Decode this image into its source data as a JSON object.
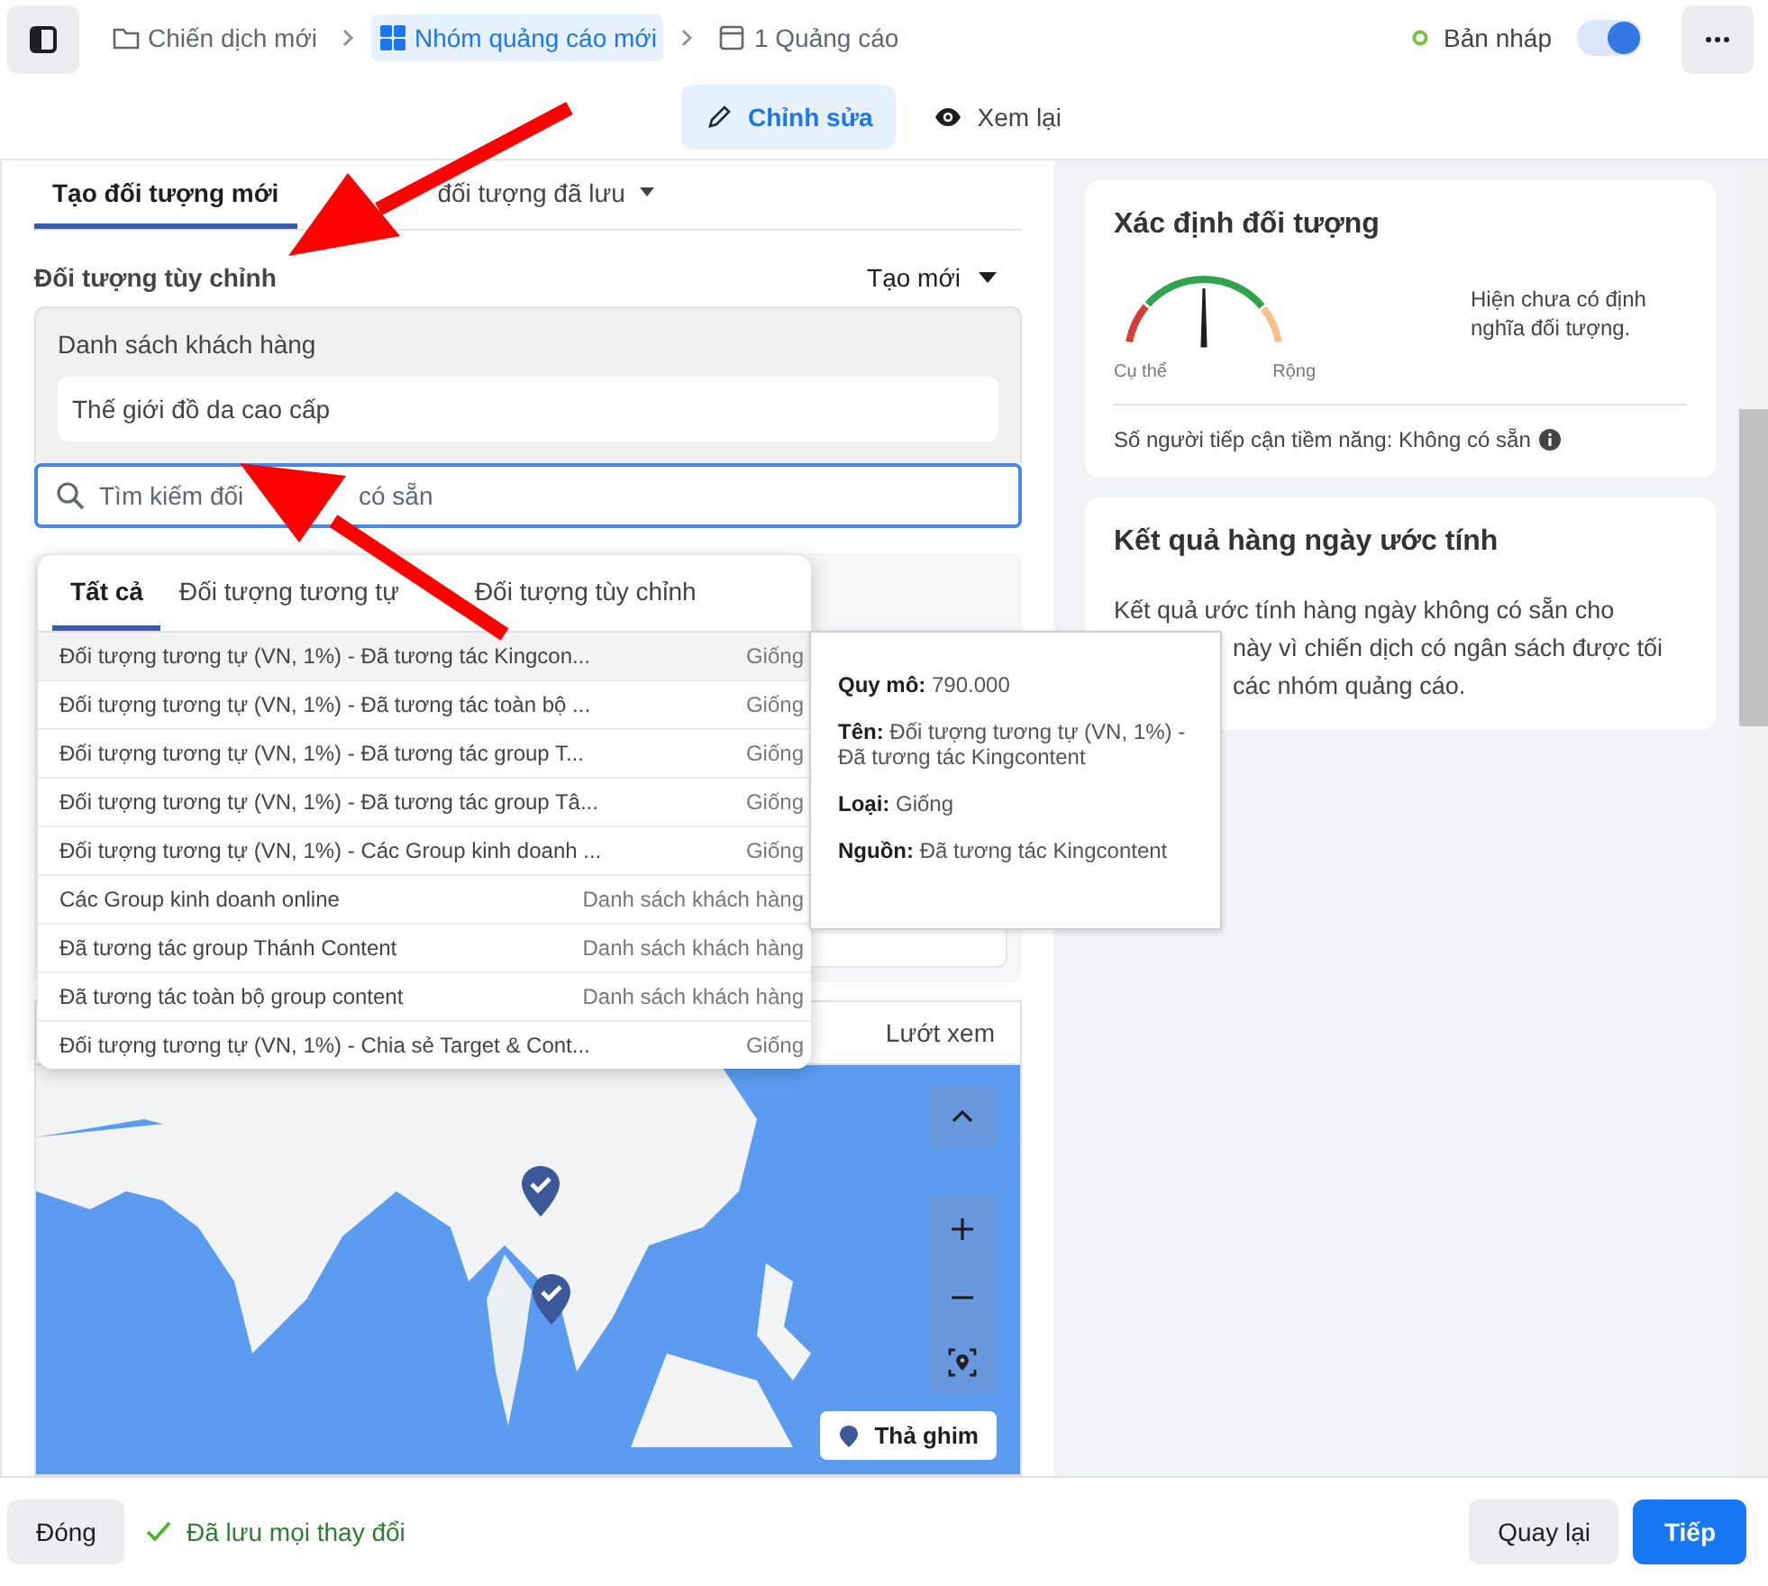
{
  "header": {
    "breadcrumbs": [
      {
        "label": "Chiến dịch mới",
        "kind": "campaign",
        "selected": false
      },
      {
        "label": "Nhóm quảng cáo mới",
        "kind": "adset",
        "selected": true
      },
      {
        "label": "1 Quảng cáo",
        "kind": "ad",
        "selected": false
      }
    ],
    "status": "Bản nháp",
    "toggle": {
      "on": true
    }
  },
  "modes": [
    {
      "label": "Chỉnh sửa",
      "kind": "edit",
      "selected": true
    },
    {
      "label": "Xem lại",
      "kind": "view",
      "selected": false
    }
  ],
  "audience_tabs": [
    {
      "label": "Tạo đối tượng mới",
      "selected": true,
      "dropdown": false
    },
    {
      "label": "đối tượng đã lưu",
      "selected": false,
      "dropdown": true
    }
  ],
  "custom_audience": {
    "title": "Đối tượng tùy chỉnh",
    "create_button": "Tạo mới",
    "group_label": "Danh sách khách hàng",
    "chips": [
      "Thế giới đồ da cao cấp"
    ],
    "search": {
      "placeholder": "Tìm kiếm đối",
      "placeholder_end": "có sẵn"
    }
  },
  "dropdown": {
    "tabs": [
      {
        "label": "Tất cả",
        "selected": true
      },
      {
        "label": "Đối tượng tương tự",
        "selected": false
      },
      {
        "label": "Đối tượng tùy chỉnh",
        "selected": false
      }
    ],
    "rows": [
      {
        "name": "Đối tượng tương tự (VN, 1%) - Đã tương tác Kingcon...",
        "type": "Giống",
        "highlighted": true
      },
      {
        "name": "Đối tượng tương tự (VN, 1%) - Đã tương tác toàn bộ ...",
        "type": "Giống",
        "highlighted": false
      },
      {
        "name": "Đối tượng tương tự (VN, 1%) - Đã tương tác group T...",
        "type": "Giống",
        "highlighted": false
      },
      {
        "name": "Đối tượng tương tự (VN, 1%) - Đã tương tác group Tâ...",
        "type": "Giống",
        "highlighted": false
      },
      {
        "name": "Đối tượng tương tự (VN, 1%) - Các Group kinh doanh ...",
        "type": "Giống",
        "highlighted": false
      },
      {
        "name": "Các Group kinh doanh online",
        "type": "Danh sách khách hàng",
        "highlighted": false
      },
      {
        "name": "Đã tương tác group Thánh Content",
        "type": "Danh sách khách hàng",
        "highlighted": false
      },
      {
        "name": "Đã tương tác toàn bộ group content",
        "type": "Danh sách khách hàng",
        "highlighted": false
      },
      {
        "name": "Đối tượng tương tự (VN, 1%) - Chia sẻ Target & Cont...",
        "type": "Giống",
        "highlighted": false
      }
    ]
  },
  "tooltip": {
    "lines": [
      "**Quy mô:** 790.000",
      "**Tên:** Đối tượng tương tự (VN, 1%) - Đã tương tác Kingcontent",
      "**Loại:** Giống",
      "**Nguồn:** Đã tương tác Kingcontent"
    ]
  },
  "location": {
    "browse": "Lướt xem",
    "pin_button": "Thả ghim",
    "map_buttons": [
      {
        "kind": "up"
      },
      {
        "kind": "zoom_in"
      },
      {
        "kind": "zoom_out"
      },
      {
        "kind": "locate"
      }
    ],
    "pins": [
      {
        "kind": "check"
      },
      {
        "kind": "check"
      }
    ]
  },
  "audience_definition": {
    "title": "Xác định đối tượng",
    "gauge_low": "Cụ thể",
    "gauge_high": "Rộng",
    "description": "Hiện chưa có định nghĩa đối tượng.",
    "reach": "Số người tiếp cận tiềm năng: Không có sẵn"
  },
  "daily_results": {
    "title": "Kết quả hàng ngày ước tính",
    "lines": [
      {
        "text": "Kết quả ước tính hàng ngày không có sẵn cho",
        "clipped": false
      },
      {
        "text": "này vì chiến dịch có ngân sách được tối",
        "clipped": true
      },
      {
        "text": "các nhóm quảng cáo.",
        "clipped": true
      }
    ]
  },
  "footer": {
    "close": "Đóng",
    "saved": "Đã lưu mọi thay đổi",
    "back": "Quay lại",
    "next": "Tiếp"
  },
  "annotations": [
    {
      "kind": "arrow"
    },
    {
      "kind": "arrow"
    }
  ]
}
